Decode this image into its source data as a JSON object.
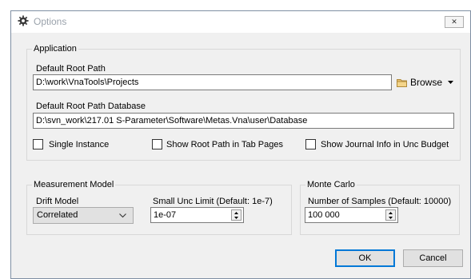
{
  "window": {
    "title": "Options",
    "close_glyph": "✕"
  },
  "application": {
    "legend": "Application",
    "root_path_label": "Default Root Path",
    "root_path_value": "D:\\work\\VnaTools\\Projects",
    "browse_label": "Browse",
    "root_db_label": "Default Root Path Database",
    "root_db_value": "D:\\svn_work\\217.01 S-Parameter\\Software\\Metas.Vna\\user\\Database",
    "checkboxes": [
      {
        "label": "Single Instance",
        "checked": false
      },
      {
        "label": "Show Root Path in Tab Pages",
        "checked": false
      },
      {
        "label": "Show Journal Info in Unc Budget",
        "checked": false
      }
    ]
  },
  "measurement_model": {
    "legend": "Measurement Model",
    "drift_label": "Drift Model",
    "drift_value": "Correlated",
    "unc_limit_label": "Small Unc Limit (Default: 1e-7)",
    "unc_limit_value": "1e-07"
  },
  "monte_carlo": {
    "legend": "Monte Carlo",
    "samples_label": "Number of Samples (Default: 10000)",
    "samples_value": "100 000"
  },
  "buttons": {
    "ok": "OK",
    "cancel": "Cancel"
  },
  "icons": [
    "gear-icon",
    "close-icon",
    "folder-icon",
    "dropdown-arrow-icon",
    "chevron-down-icon",
    "spin-up-icon",
    "spin-down-icon"
  ]
}
